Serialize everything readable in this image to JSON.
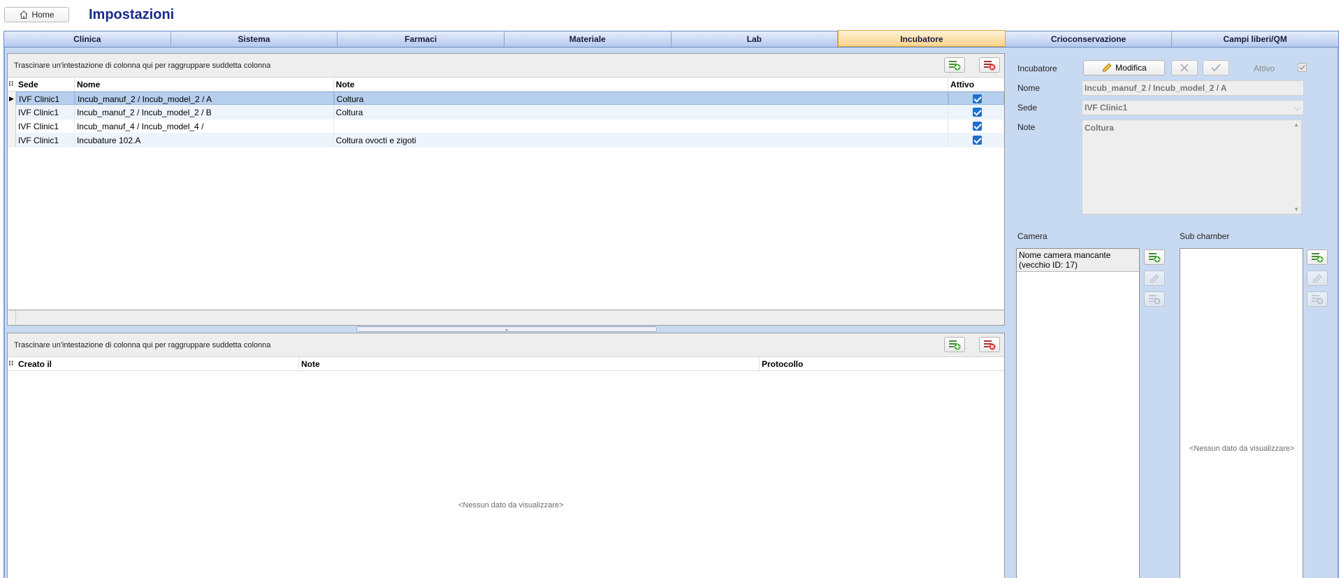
{
  "header": {
    "home_label": "Home",
    "page_title": "Impostazioni"
  },
  "tabs": [
    {
      "label": "Clinica"
    },
    {
      "label": "Sistema"
    },
    {
      "label": "Farmaci"
    },
    {
      "label": "Materiale"
    },
    {
      "label": "Lab"
    },
    {
      "label": "Incubatore",
      "active": true
    },
    {
      "label": "Crioconservazione"
    },
    {
      "label": "Campi liberi/QM"
    }
  ],
  "incubators_grid": {
    "group_hint": "Trascinare un'intestazione di colonna qui per raggruppare suddetta colonna",
    "columns": {
      "sede": "Sede",
      "nome": "Nome",
      "note": "Note",
      "attivo": "Attivo"
    },
    "rows": [
      {
        "sede": "IVF Clinic1",
        "nome": "Incub_manuf_2 / Incub_model_2 / A",
        "note": "Coltura",
        "attivo": true
      },
      {
        "sede": "IVF Clinic1",
        "nome": "Incub_manuf_2 / Incub_model_2 / B",
        "note": "Coltura",
        "attivo": true
      },
      {
        "sede": "IVF Clinic1",
        "nome": "Incub_manuf_4 / Incub_model_4 /",
        "note": "",
        "attivo": true
      },
      {
        "sede": "IVF Clinic1",
        "nome": "Incubature 102.A",
        "note": "Coltura ovocti e zigoti",
        "attivo": true
      }
    ]
  },
  "log_grid": {
    "group_hint": "Trascinare un'intestazione di colonna qui per raggruppare suddetta colonna",
    "columns": {
      "creato": "Creato il",
      "note": "Note",
      "protocollo": "Protocollo"
    },
    "empty_text": "<Nessun dato da visualizzare>"
  },
  "detail": {
    "incubatore_label": "Incubatore",
    "modifica_label": "Modifica",
    "attivo_label": "Attivo",
    "nome_label": "Nome",
    "nome_value": "Incub_manuf_2 / Incub_model_2 / A",
    "sede_label": "Sede",
    "sede_value": "IVF Clinic1",
    "note_label": "Note",
    "note_value": "Coltura",
    "camera_label": "Camera",
    "camera_items": [
      "Nome camera mancante (vecchio ID: 17)"
    ],
    "sub_chamber_label": "Sub chamber",
    "sub_chamber_empty": "<Nessun dato da visualizzare>"
  },
  "colors": {
    "title": "#1a2b8a",
    "tab_active": "#fbd38c",
    "panel_bg": "#c8daf1",
    "selected_row": "#b7cfee",
    "checkbox": "#1f6fd1"
  }
}
